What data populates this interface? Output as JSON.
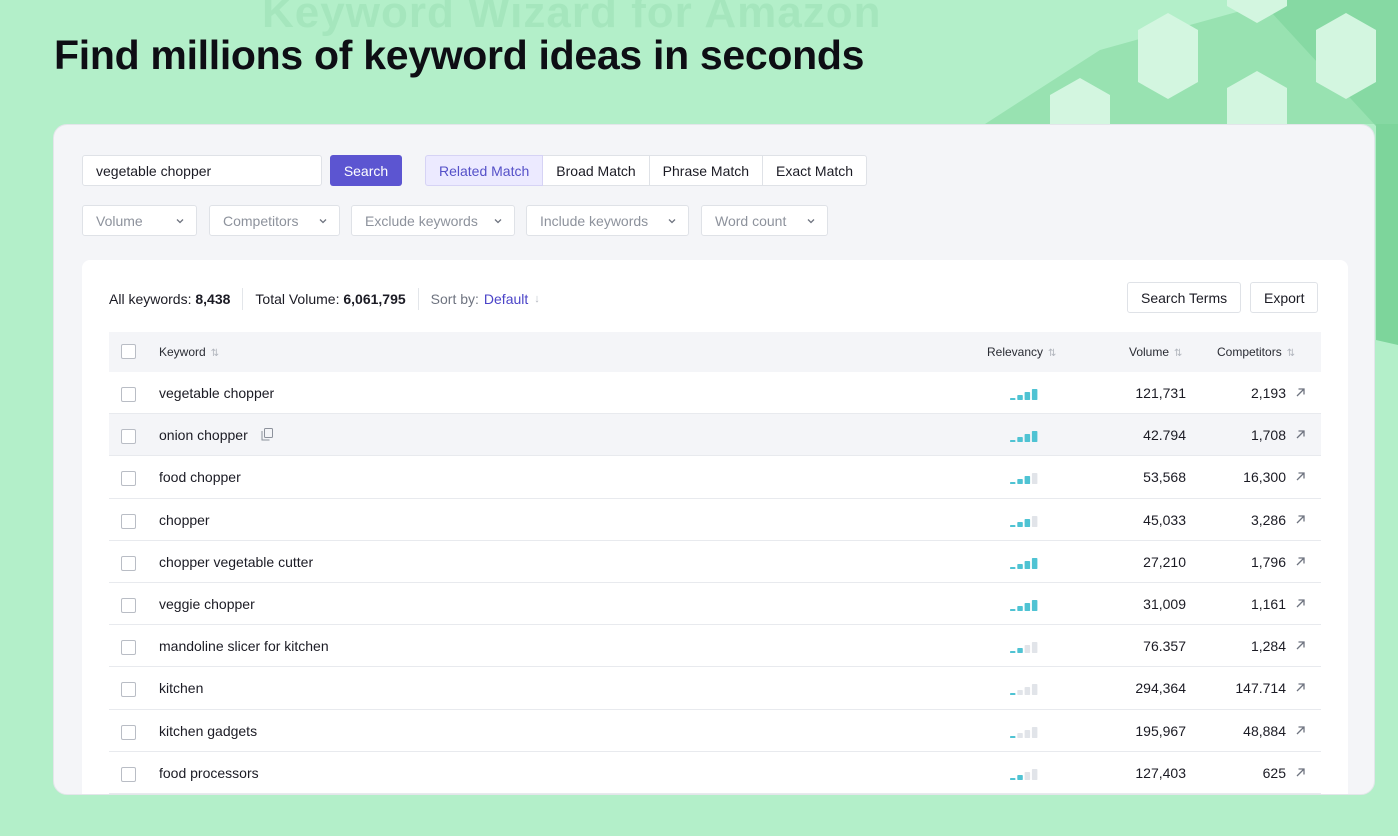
{
  "headline": "Find millions of keyword ideas in seconds",
  "search": {
    "value": "vegetable chopper",
    "button": "Search"
  },
  "match_tabs": [
    {
      "label": "Related Match",
      "active": true
    },
    {
      "label": "Broad Match",
      "active": false
    },
    {
      "label": "Phrase Match",
      "active": false
    },
    {
      "label": "Exact Match",
      "active": false
    }
  ],
  "filters": [
    "Volume",
    "Competitors",
    "Exclude keywords",
    "Include keywords",
    "Word count"
  ],
  "stats": {
    "all_keywords_label": "All keywords:",
    "all_keywords_value": "8,438",
    "total_volume_label": "Total Volume:",
    "total_volume_value": "6,061,795",
    "sort_label": "Sort by:",
    "sort_value": "Default"
  },
  "actions": {
    "search_terms": "Search Terms",
    "export": "Export"
  },
  "columns": {
    "keyword": "Keyword",
    "relevancy": "Relevancy",
    "volume": "Volume",
    "competitors": "Competitors"
  },
  "colors": {
    "accent": "#5c55d1",
    "relevancy_on": "#4fc3d3",
    "relevancy_off": "#e1e4e9",
    "background": "#b3efc9"
  },
  "rows": [
    {
      "keyword": "vegetable chopper",
      "relevancy": 4,
      "volume": "121,731",
      "competitors": "2,193"
    },
    {
      "keyword": "onion chopper",
      "relevancy": 4,
      "volume": "42.794",
      "competitors": "1,708",
      "highlight": true
    },
    {
      "keyword": "food chopper",
      "relevancy": 3,
      "volume": "53,568",
      "competitors": "16,300"
    },
    {
      "keyword": "chopper",
      "relevancy": 3,
      "volume": "45,033",
      "competitors": "3,286"
    },
    {
      "keyword": "chopper vegetable cutter",
      "relevancy": 4,
      "volume": "27,210",
      "competitors": "1,796"
    },
    {
      "keyword": "veggie chopper",
      "relevancy": 4,
      "volume": "31,009",
      "competitors": "1,161"
    },
    {
      "keyword": "mandoline slicer for kitchen",
      "relevancy": 2,
      "volume": "76.357",
      "competitors": "1,284"
    },
    {
      "keyword": "kitchen",
      "relevancy": 1,
      "volume": "294,364",
      "competitors": "147.714"
    },
    {
      "keyword": "kitchen gadgets",
      "relevancy": 1,
      "volume": "195,967",
      "competitors": "48,884"
    },
    {
      "keyword": "food processors",
      "relevancy": 2,
      "volume": "127,403",
      "competitors": "625"
    }
  ]
}
